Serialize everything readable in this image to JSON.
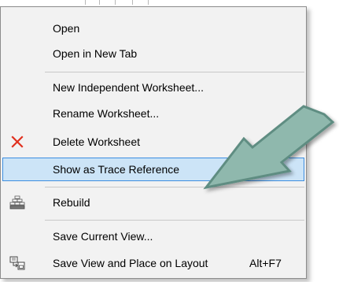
{
  "menu": {
    "items": [
      {
        "label": "Open",
        "icon": "",
        "shortcut": ""
      },
      {
        "label": "Open in New Tab",
        "icon": "",
        "shortcut": ""
      },
      {
        "label": "New Independent Worksheet...",
        "icon": "",
        "shortcut": ""
      },
      {
        "label": "Rename Worksheet...",
        "icon": "",
        "shortcut": ""
      },
      {
        "label": "Delete Worksheet",
        "icon": "delete-x-icon",
        "shortcut": ""
      },
      {
        "label": "Show as Trace Reference",
        "icon": "",
        "shortcut": "",
        "state": "highlighted"
      },
      {
        "label": "Rebuild",
        "icon": "rebuild-icon",
        "shortcut": ""
      },
      {
        "label": "Save Current View...",
        "icon": "",
        "shortcut": ""
      },
      {
        "label": "Save View and Place on Layout",
        "icon": "save-view-layout-icon",
        "shortcut": "Alt+F7"
      }
    ]
  },
  "annotation": {
    "icon": "callout-arrow-icon",
    "color": "#8fb8ad"
  },
  "colors": {
    "delete_icon": "#e0301e",
    "highlight_bg": "#cce4f7",
    "highlight_border": "#3d8ee0"
  }
}
